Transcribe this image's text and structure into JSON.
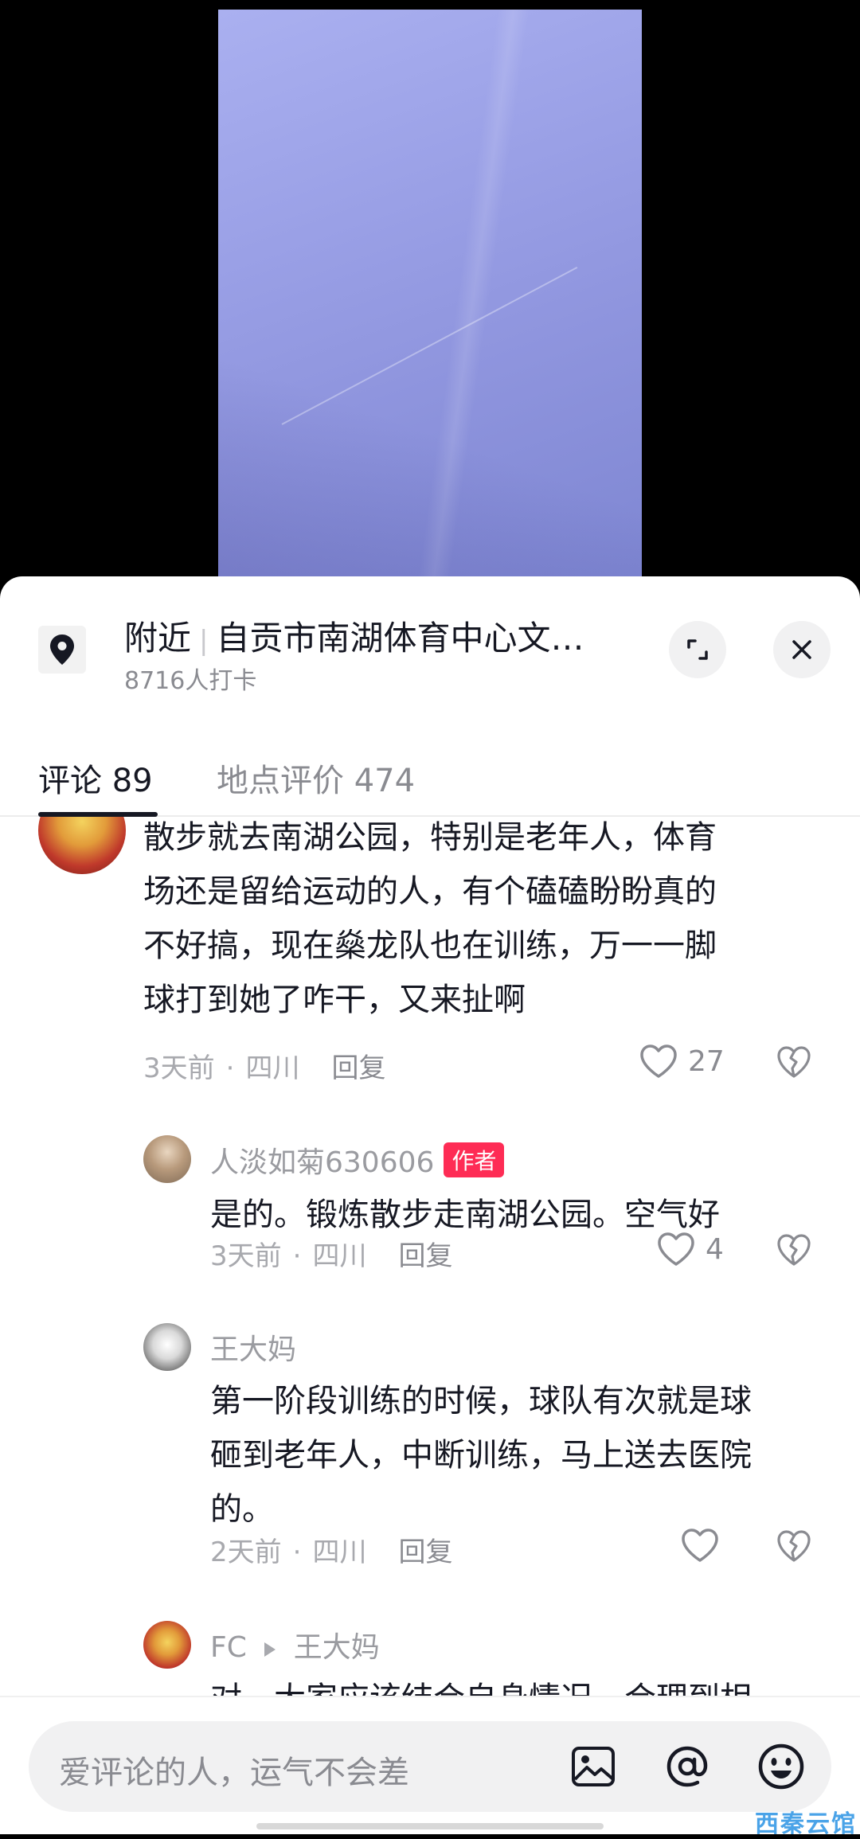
{
  "location": {
    "prefix": "附近",
    "name": "自贡市南湖体育中心文…",
    "checkins": "8716人打卡"
  },
  "tabs": [
    {
      "label": "评论 89"
    },
    {
      "label": "地点评价 474"
    }
  ],
  "comments": [
    {
      "text_lines": [
        "散步就去南湖公园，特别是老年人，体育",
        "场还是留给运动的人，有个磕磕盼盼真的",
        "不好搞，现在燊龙队也在训练，万一一脚",
        "球打到她了咋干，又来扯啊"
      ],
      "time": "3天前",
      "region": "四川",
      "reply_label": "回复",
      "likes": "27"
    },
    {
      "user": "人淡如菊630606",
      "badge": "作者",
      "text_lines": [
        "是的。锻炼散步走南湖公园。空气好"
      ],
      "time": "3天前",
      "region": "四川",
      "reply_label": "回复",
      "likes": "4"
    },
    {
      "user": "王大妈",
      "text_lines": [
        "第一阶段训练的时候，球队有次就是球",
        "砸到老年人，中断训练，马上送去医院",
        "的。"
      ],
      "time": "2天前",
      "region": "四川",
      "reply_label": "回复",
      "likes": ""
    },
    {
      "user": "FC",
      "reply_to": "王大妈",
      "text_lines": [
        "对，大家应该结合自身情况，合理到相"
      ]
    }
  ],
  "input": {
    "placeholder": "爱评论的人，运气不会差"
  },
  "icons": [
    "location-pin-icon",
    "expand-icon",
    "close-icon",
    "heart-icon",
    "dislike-heart-icon",
    "image-icon",
    "at-icon",
    "emoji-icon"
  ],
  "watermark": "西秦云馆",
  "colors": {
    "accent": "#fe2c55",
    "text": "#161823",
    "muted": "#8a8b91"
  }
}
